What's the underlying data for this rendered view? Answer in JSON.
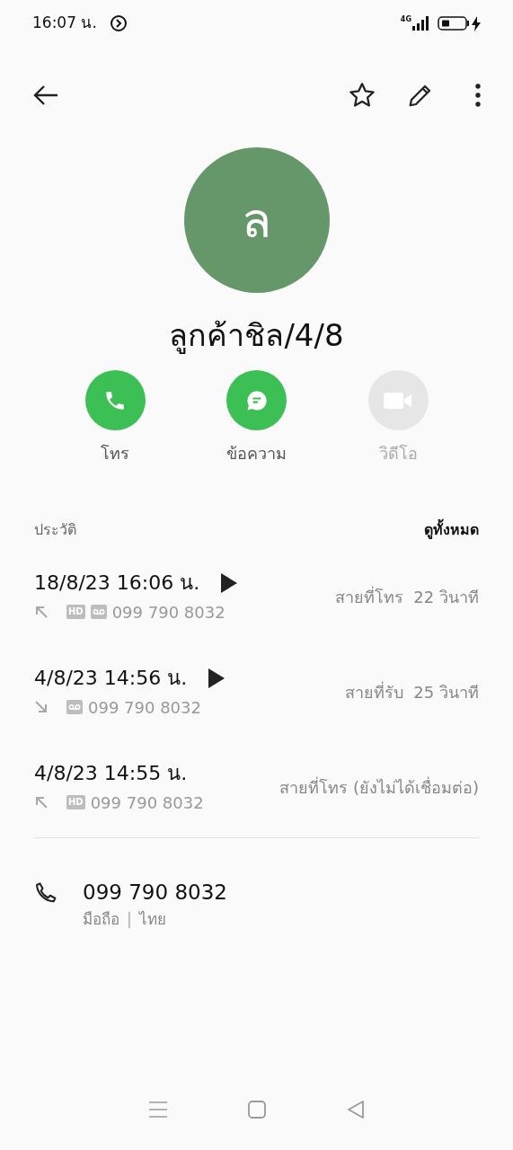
{
  "status_bar": {
    "time": "16:07 น.",
    "network": "4G"
  },
  "contact": {
    "initial": "ล",
    "name": "ลูกค้าชิล/4/8"
  },
  "actions": [
    {
      "kind": "call",
      "label": "โทร",
      "disabled": false
    },
    {
      "kind": "message",
      "label": "ข้อความ",
      "disabled": false
    },
    {
      "kind": "video",
      "label": "วิดีโอ",
      "disabled": true
    }
  ],
  "history": {
    "title": "ประวัติ",
    "view_all": "ดูทั้งหมด",
    "calls": [
      {
        "datetime": "18/8/23 16:06 น.",
        "kind": "outgoing",
        "playable": true,
        "badge": "HD",
        "recorded": true,
        "number": "099 790 8032",
        "status": "สายที่โทร  22 วินาที"
      },
      {
        "datetime": "4/8/23 14:56 น.",
        "kind": "incoming",
        "playable": true,
        "recorded": true,
        "number": "099 790 8032",
        "status": "สายที่รับ  25 วินาที"
      },
      {
        "datetime": "4/8/23 14:55 น.",
        "kind": "outgoing",
        "playable": false,
        "badge": "HD",
        "recorded": false,
        "number": "099 790 8032",
        "status": "สายที่โทร (ยังไม่ได้เชื่อมต่อ)"
      }
    ]
  },
  "phone": {
    "number": "099 790 8032",
    "type": "มือถือ",
    "separator": "|",
    "region": "ไทย"
  }
}
